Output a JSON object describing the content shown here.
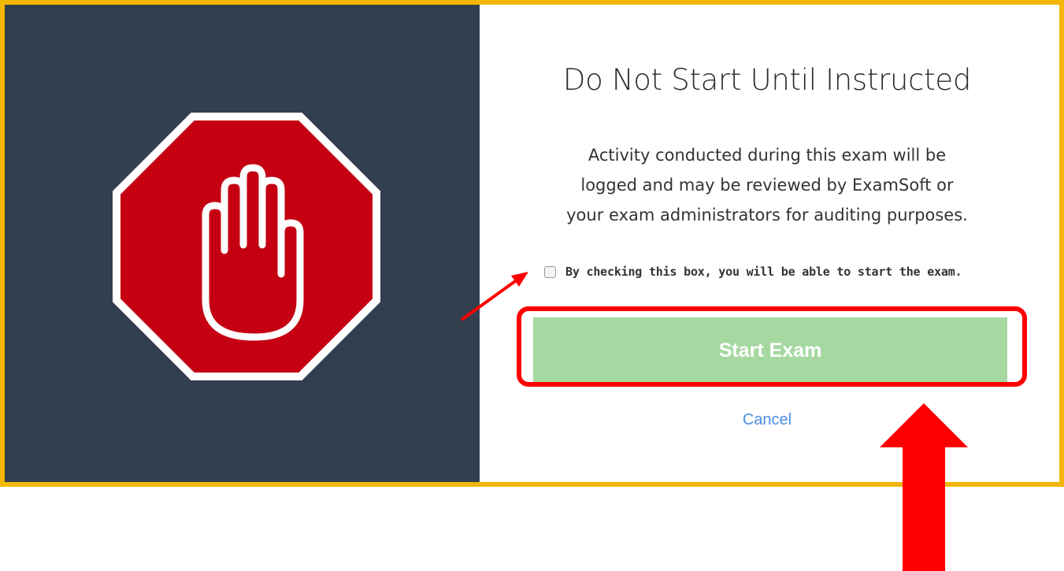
{
  "dialog": {
    "title": "Do Not Start Until Instructed",
    "notice_lines": [
      "Activity conducted during this exam will be",
      "logged and may be reviewed by ExamSoft or",
      "your exam administrators for auditing purposes."
    ],
    "consent_label": "By checking this box, you will be able to start the exam.",
    "consent_checked": false,
    "start_button_label": "Start Exam",
    "start_button_enabled": false,
    "cancel_label": "Cancel"
  },
  "icons": {
    "stop_sign": "stop-hand-icon"
  },
  "colors": {
    "frame_border": "#f2b705",
    "left_panel": "#323f4f",
    "stop_red": "#c40012",
    "start_button_disabled": "#a6d9a1",
    "cancel_link": "#4a90e2",
    "annotation_red": "#ff0000"
  }
}
